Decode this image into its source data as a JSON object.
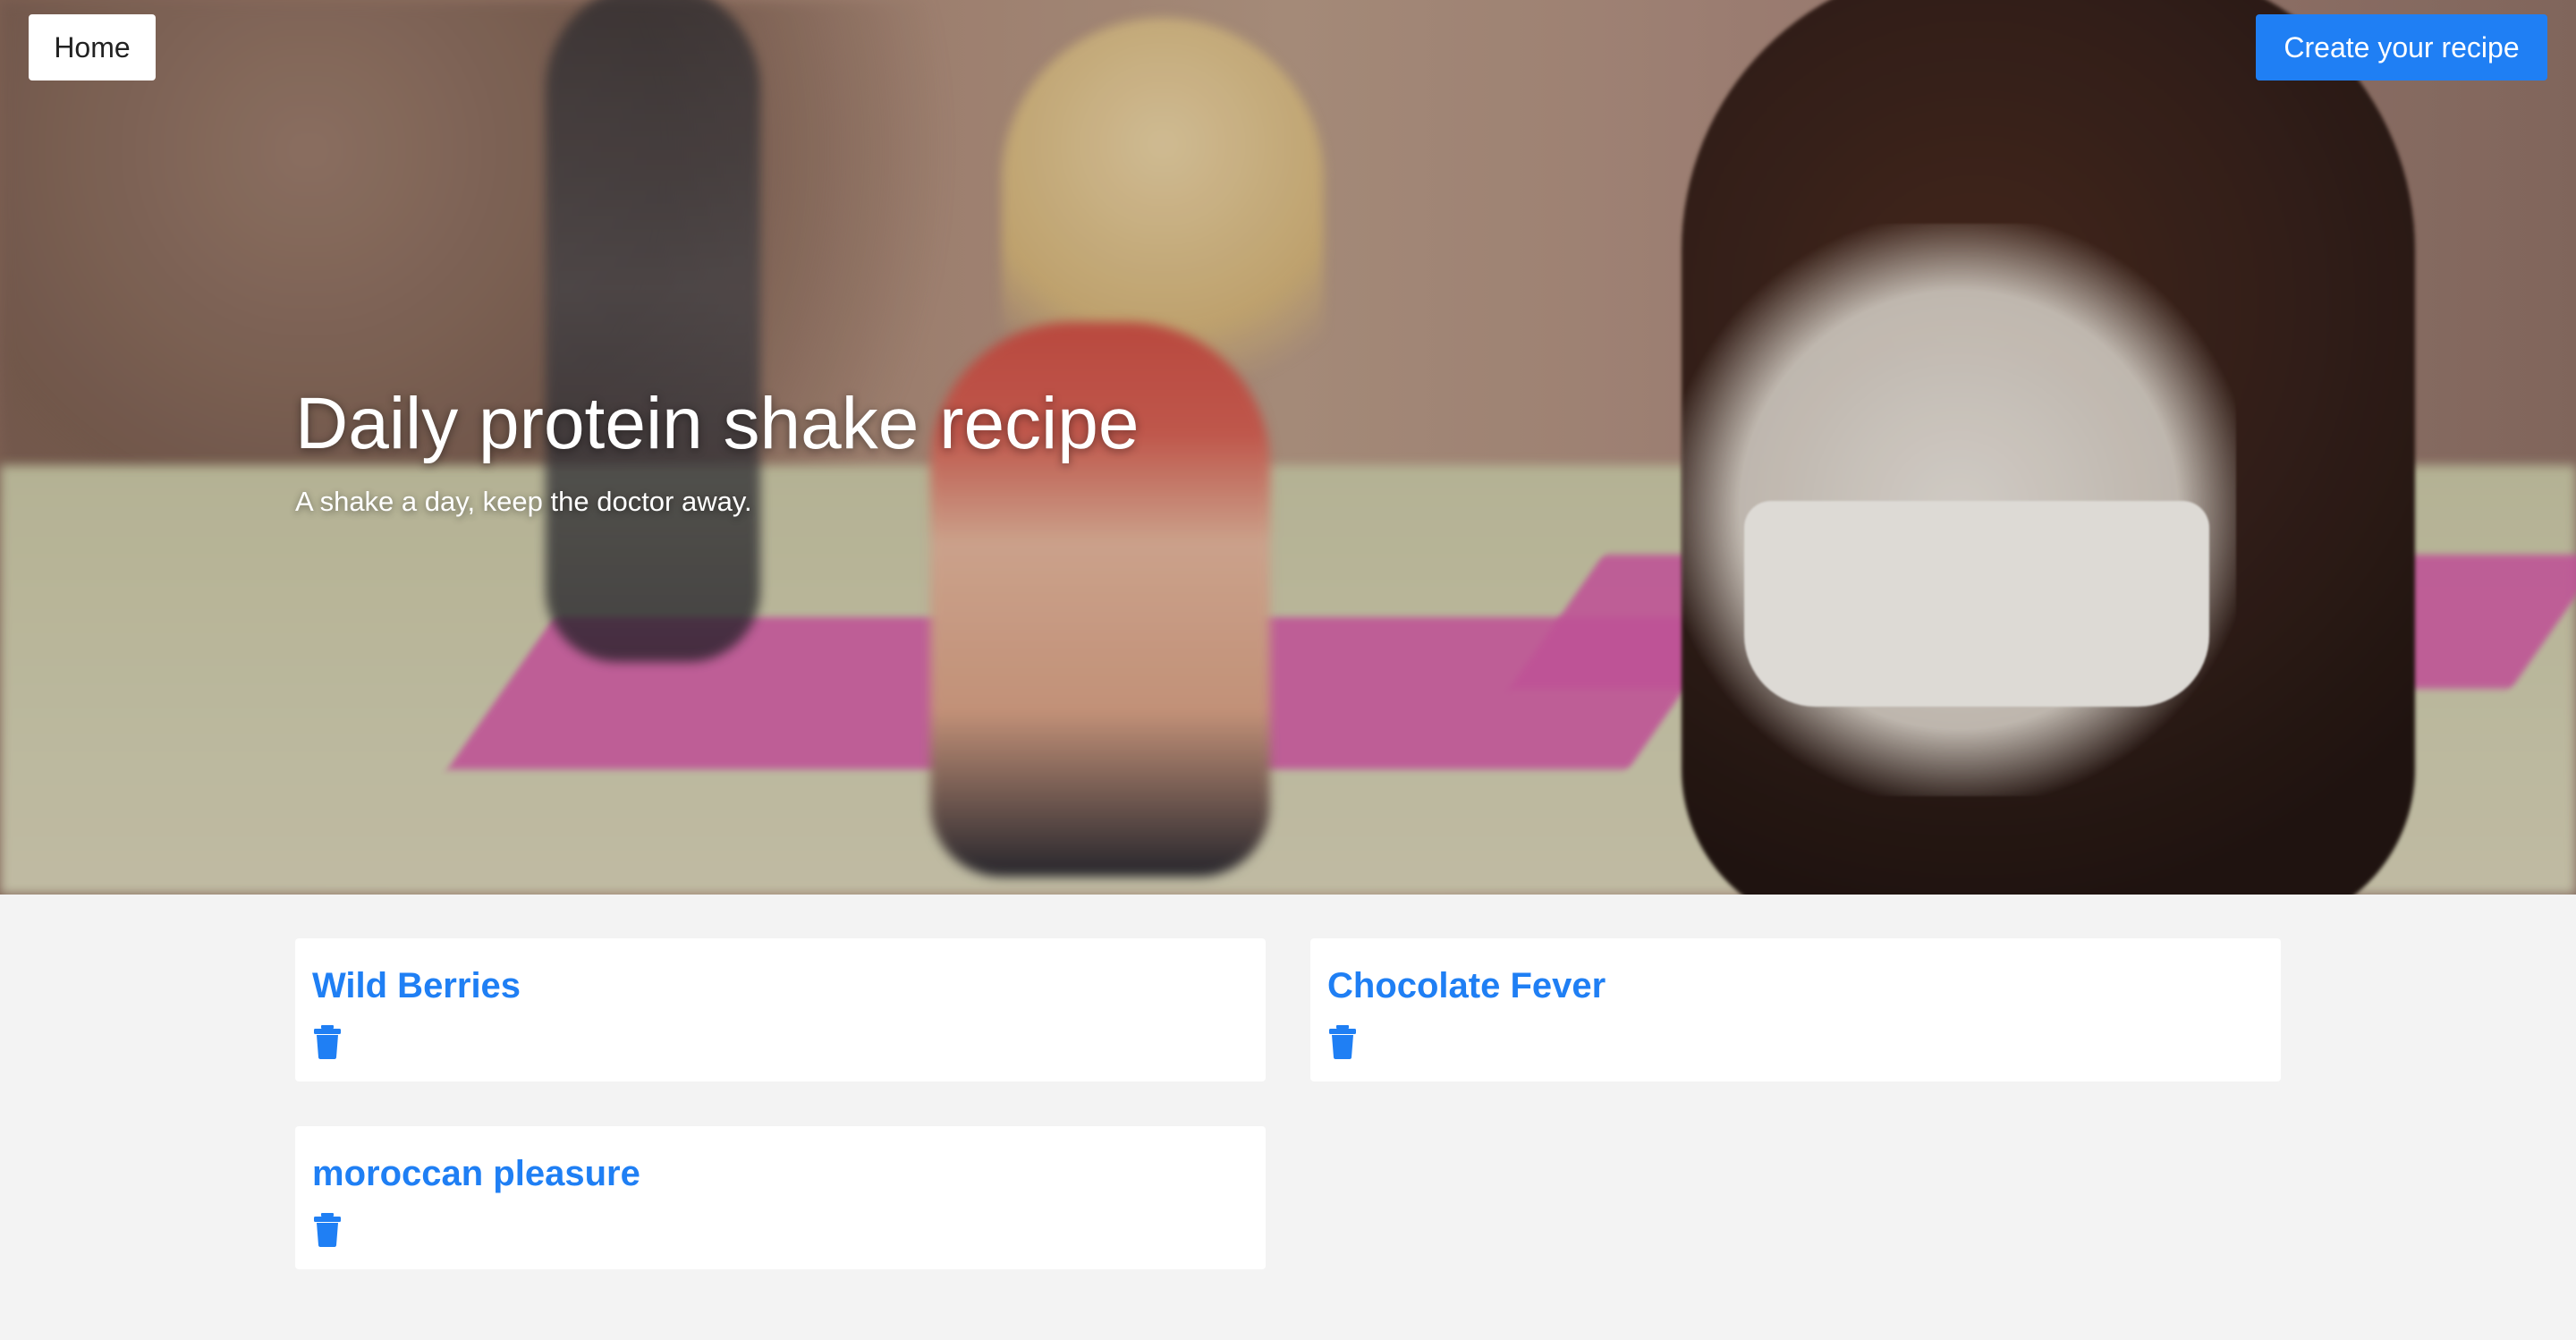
{
  "nav": {
    "home_label": "Home",
    "create_label": "Create your recipe"
  },
  "hero": {
    "title": "Daily protein shake recipe",
    "subtitle": "A shake a day, keep the doctor away."
  },
  "recipes": [
    {
      "name": "Wild Berries",
      "icon": "trash-icon"
    },
    {
      "name": "Chocolate Fever",
      "icon": "trash-icon"
    },
    {
      "name": "moroccan pleasure",
      "icon": "trash-icon"
    }
  ],
  "colors": {
    "accent": "#1f7ff4",
    "page_background": "#f3f3f3",
    "card_background": "#ffffff"
  }
}
